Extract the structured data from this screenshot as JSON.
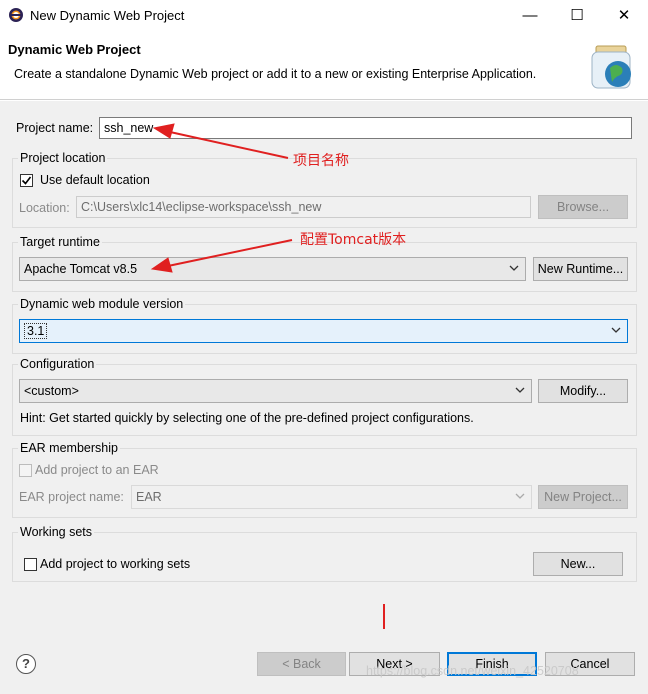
{
  "window": {
    "title": "New Dynamic Web Project",
    "minimize_glyph": "—",
    "maximize_glyph": "☐",
    "close_glyph": "✕"
  },
  "banner": {
    "title": "Dynamic Web Project",
    "description": "Create a standalone Dynamic Web project or add it to a new or existing Enterprise Application."
  },
  "project_name": {
    "label": "Project name:",
    "value": "ssh_new"
  },
  "project_location": {
    "group_title": "Project location",
    "use_default_label": "Use default location",
    "use_default_checked": true,
    "location_label": "Location:",
    "location_value": "C:\\Users\\xlc14\\eclipse-workspace\\ssh_new",
    "browse_label": "Browse..."
  },
  "target_runtime": {
    "group_title": "Target runtime",
    "selected": "Apache Tomcat v8.5",
    "new_runtime_label": "New Runtime..."
  },
  "module_version": {
    "group_title": "Dynamic web module version",
    "selected": "3.1"
  },
  "configuration": {
    "group_title": "Configuration",
    "selected": "<custom>",
    "modify_label": "Modify...",
    "hint": "Hint: Get started quickly by selecting one of the pre-defined project configurations."
  },
  "ear": {
    "group_title": "EAR membership",
    "add_label": "Add project to an EAR",
    "add_checked": false,
    "name_label": "EAR project name:",
    "name_value": "EAR",
    "new_project_label": "New Project..."
  },
  "working_sets": {
    "group_title": "Working sets",
    "add_label": "Add project to working sets",
    "add_checked": false,
    "new_label": "New..."
  },
  "annotations": {
    "project_name_note": "项目名称",
    "runtime_note": "配置Tomcat版本"
  },
  "footer": {
    "help_glyph": "?",
    "back_label": "< Back",
    "next_label": "Next >",
    "finish_label": "Finish",
    "cancel_label": "Cancel"
  },
  "watermark": "https://blog.csdn.net/weixin_42520708",
  "colors": {
    "annotation_red": "#e02020",
    "focus_blue": "#0078d7",
    "dialog_bg": "#f0f0f0"
  }
}
